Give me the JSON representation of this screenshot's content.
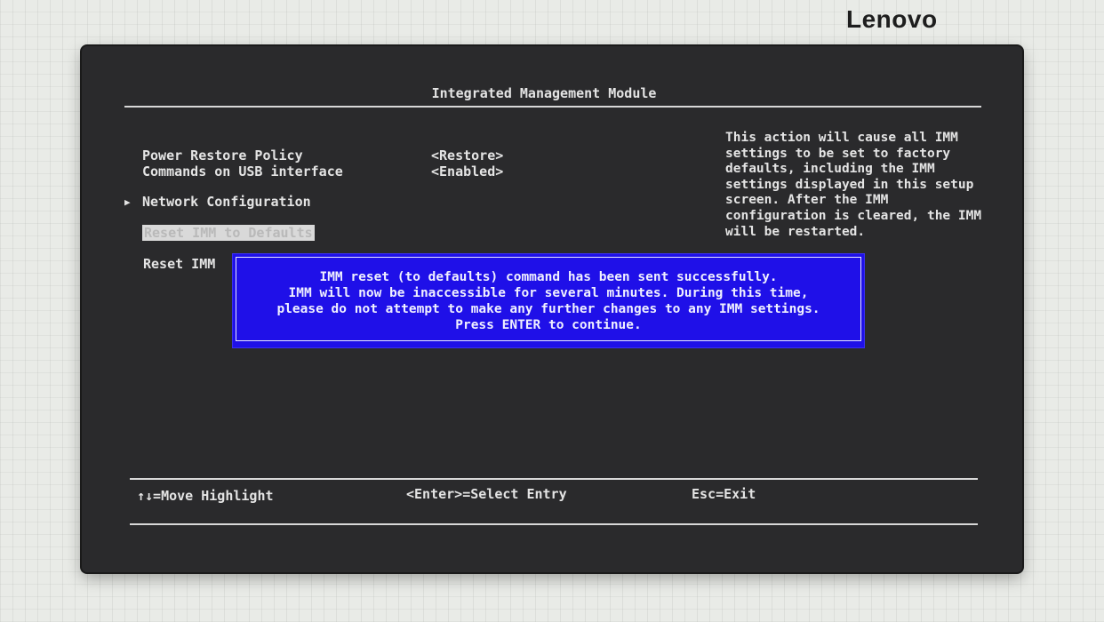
{
  "brand": {
    "name": "Lenovo"
  },
  "screen": {
    "title": "Integrated Management Module",
    "settings": [
      {
        "label": "Power Restore Policy",
        "value": "<Restore>"
      },
      {
        "label": "Commands on USB interface",
        "value": "<Enabled>"
      }
    ],
    "menu": {
      "submenu_marker": "▶",
      "network_configuration": "Network Configuration",
      "reset_to_defaults": "Reset IMM to Defaults",
      "reset_imm": "Reset IMM"
    },
    "help_text": "This action will cause all IMM settings to be set to factory defaults, including the IMM settings displayed in this setup screen. After the IMM configuration is cleared, the IMM will be restarted.",
    "dialog": {
      "lines": [
        "IMM reset (to defaults) command has been sent successfully.",
        "IMM will now be inaccessible for several minutes. During this time,",
        "please do not attempt to make any further changes to any IMM settings.",
        "Press ENTER to continue."
      ]
    },
    "footer": {
      "move": "↑↓=Move Highlight",
      "select": "<Enter>=Select Entry",
      "exit": "Esc=Exit"
    }
  }
}
